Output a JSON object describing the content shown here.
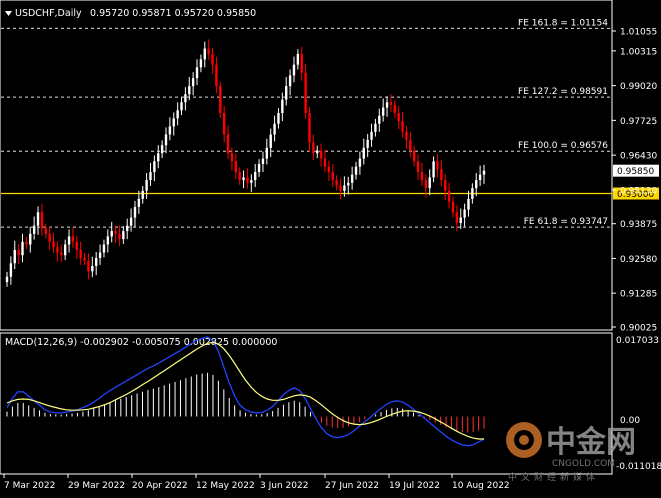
{
  "header": {
    "symbol": "USDCHF,Daily",
    "ohlc": "0.95720 0.95871 0.95720 0.95850"
  },
  "macd": {
    "label": "MACD(12,26,9) -0.002902 -0.005075 0.002825 0.000000",
    "ticks": [
      "0.017033",
      "0.00",
      "-0.011018"
    ]
  },
  "colors": {
    "background": "#000000",
    "grid": "#ffffff",
    "bull": "#ffffff",
    "bear": "#ff0000",
    "level": "#ffd700",
    "macd": "#2244ff",
    "signal": "#ffff80",
    "hist_pos": "#ffffff",
    "hist_neg": "#ff3030"
  },
  "chart_data": {
    "type": "candlestick",
    "title": "USDCHF,Daily",
    "ylim": [
      0.9,
      1.02
    ],
    "price_ticks": [
      "1.01055",
      "1.00315",
      "0.99020",
      "0.97725",
      "0.96430",
      "0.95130",
      "0.93875",
      "0.92580",
      "0.91285",
      "0.90025"
    ],
    "x_labels": [
      "7 Mar 2022",
      "29 Mar 2022",
      "20 Apr 2022",
      "12 May 2022",
      "3 Jun 2022",
      "27 Jun 2022",
      "19 Jul 2022",
      "10 Aug 2022"
    ],
    "current_price": "0.95850",
    "level_price": "0.95000",
    "fib_levels": [
      {
        "label": "FE 161.8 = 1.01154",
        "value": 1.01154
      },
      {
        "label": "FE 127.2 = 0.98591",
        "value": 0.98591
      },
      {
        "label": "FE 100.0 = 0.96576",
        "value": 0.96576
      },
      {
        "label": "FE 61.8 = 0.93747",
        "value": 0.93747
      }
    ],
    "closes": [
      0.919,
      0.924,
      0.929,
      0.927,
      0.932,
      0.931,
      0.935,
      0.938,
      0.943,
      0.937,
      0.935,
      0.932,
      0.93,
      0.928,
      0.927,
      0.931,
      0.934,
      0.932,
      0.929,
      0.926,
      0.925,
      0.921,
      0.923,
      0.926,
      0.928,
      0.931,
      0.934,
      0.936,
      0.935,
      0.933,
      0.936,
      0.938,
      0.941,
      0.945,
      0.948,
      0.951,
      0.955,
      0.958,
      0.962,
      0.965,
      0.968,
      0.972,
      0.975,
      0.978,
      0.981,
      0.984,
      0.987,
      0.99,
      0.993,
      0.997,
      1.0,
      1.004,
      1.002,
      0.998,
      0.99,
      0.98,
      0.972,
      0.965,
      0.962,
      0.958,
      0.955,
      0.956,
      0.954,
      0.955,
      0.958,
      0.961,
      0.963,
      0.967,
      0.972,
      0.976,
      0.98,
      0.985,
      0.99,
      0.994,
      0.998,
      1.002,
      0.995,
      0.98,
      0.969,
      0.965,
      0.966,
      0.963,
      0.96,
      0.958,
      0.955,
      0.953,
      0.951,
      0.953,
      0.954,
      0.957,
      0.96,
      0.963,
      0.967,
      0.97,
      0.973,
      0.976,
      0.979,
      0.982,
      0.984,
      0.983,
      0.98,
      0.977,
      0.973,
      0.97,
      0.966,
      0.962,
      0.958,
      0.955,
      0.952,
      0.956,
      0.962,
      0.959,
      0.955,
      0.951,
      0.947,
      0.943,
      0.939,
      0.941,
      0.944,
      0.948,
      0.952,
      0.955,
      0.957,
      0.9585
    ],
    "macd": {
      "macd": [
        0.002,
        0.004,
        0.0055,
        0.0055,
        0.0045,
        0.0035,
        0.0025,
        0.0015,
        0.001,
        0.0008,
        0.0008,
        0.001,
        0.0012,
        0.0015,
        0.002,
        0.0025,
        0.0032,
        0.004,
        0.005,
        0.0058,
        0.0065,
        0.0072,
        0.0079,
        0.0086,
        0.0093,
        0.01,
        0.0107,
        0.0113,
        0.0119,
        0.0126,
        0.0133,
        0.014,
        0.0147,
        0.0155,
        0.0162,
        0.017,
        0.0174,
        0.0177,
        0.0168,
        0.0145,
        0.011,
        0.0075,
        0.0045,
        0.0025,
        0.0015,
        0.001,
        0.0008,
        0.0009,
        0.0014,
        0.0022,
        0.0035,
        0.0048,
        0.0058,
        0.0064,
        0.0058,
        0.004,
        0.0018,
        -0.0005,
        -0.0025,
        -0.0038,
        -0.0045,
        -0.0047,
        -0.0045,
        -0.004,
        -0.0032,
        -0.0022,
        -0.0012,
        -0.0002,
        0.0008,
        0.0018,
        0.0027,
        0.0033,
        0.0035,
        0.0032,
        0.0025,
        0.0016,
        0.0006,
        -0.0004,
        -0.0014,
        -0.0024,
        -0.0034,
        -0.0044,
        -0.0052,
        -0.0058,
        -0.0063,
        -0.0065,
        -0.0063,
        -0.0057,
        -0.005
      ],
      "signal": [
        0.003,
        0.0035,
        0.0038,
        0.0039,
        0.0038,
        0.0035,
        0.0031,
        0.0027,
        0.0023,
        0.002,
        0.0017,
        0.0015,
        0.0014,
        0.0014,
        0.0015,
        0.0016,
        0.0019,
        0.0022,
        0.0026,
        0.0031,
        0.0037,
        0.0043,
        0.0049,
        0.0056,
        0.0063,
        0.0071,
        0.0078,
        0.0086,
        0.0094,
        0.0102,
        0.011,
        0.0118,
        0.0126,
        0.0134,
        0.0142,
        0.015,
        0.0157,
        0.0163,
        0.0165,
        0.0161,
        0.0151,
        0.0136,
        0.0118,
        0.0099,
        0.0081,
        0.0066,
        0.0054,
        0.0045,
        0.0039,
        0.0036,
        0.0036,
        0.0038,
        0.0042,
        0.0046,
        0.0048,
        0.0047,
        0.0043,
        0.0035,
        0.0026,
        0.0016,
        0.0006,
        -0.0002,
        -0.0009,
        -0.0014,
        -0.0017,
        -0.0018,
        -0.0017,
        -0.0014,
        -0.001,
        -0.0005,
        0.0,
        0.0005,
        0.0009,
        0.0012,
        0.0013,
        0.0012,
        0.001,
        0.0006,
        0.0001,
        -0.0005,
        -0.0012,
        -0.0019,
        -0.0026,
        -0.0033,
        -0.0039,
        -0.0044,
        -0.0048,
        -0.005,
        -0.005
      ]
    }
  }
}
